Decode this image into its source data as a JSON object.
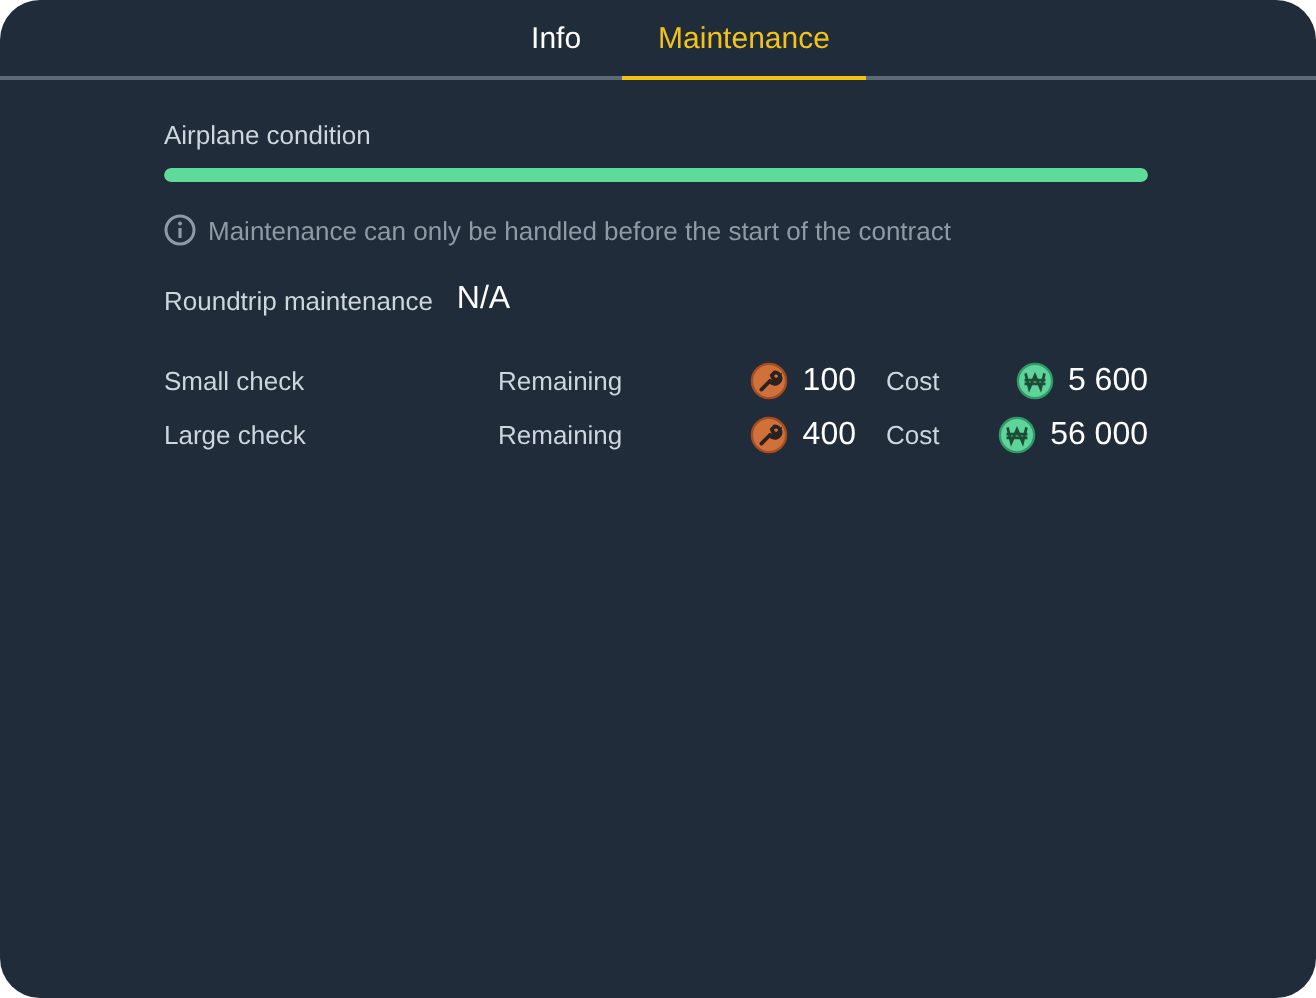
{
  "tabs": [
    {
      "label": "Info",
      "selected": false
    },
    {
      "label": "Maintenance",
      "selected": true
    }
  ],
  "condition": {
    "label": "Airplane condition",
    "level": 1
  },
  "notice": "Maintenance can only be handled before the start of the contract",
  "roundtrip": {
    "label": "Roundtrip maintenance",
    "value": "N/A"
  },
  "checks": [
    {
      "name": "Small check",
      "remaining_label": "Remaining",
      "remaining": "100",
      "cost_label": "Cost",
      "cost": "5 600"
    },
    {
      "name": "Large check",
      "remaining_label": "Remaining",
      "remaining": "400",
      "cost_label": "Cost",
      "cost": "56 000"
    }
  ]
}
